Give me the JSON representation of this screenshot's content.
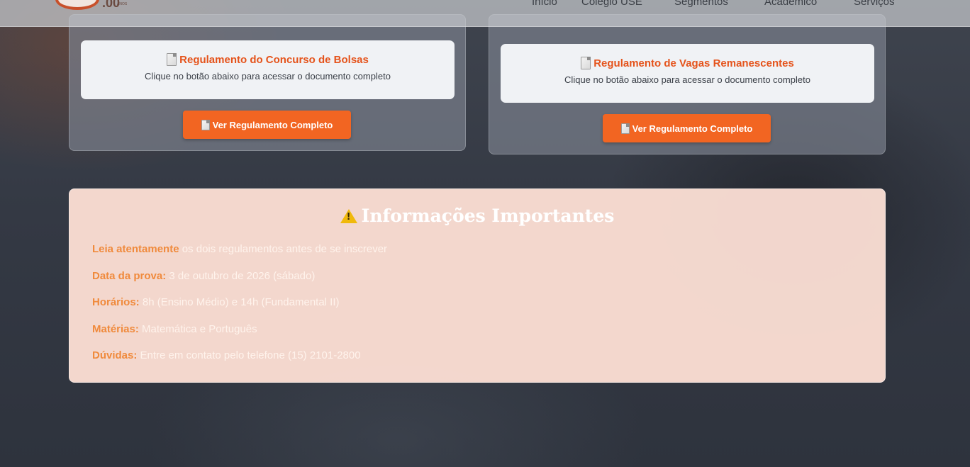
{
  "header": {
    "logo_text": ".00",
    "logo_sub": "ANOS",
    "nav": [
      {
        "label": "Início"
      },
      {
        "label": "Colégio USE"
      },
      {
        "label": "Segmentos"
      },
      {
        "label": "Acadêmico"
      },
      {
        "label": "Serviços"
      }
    ]
  },
  "documents": [
    {
      "icon": "document-icon",
      "title": "Regulamento do Concurso de Bolsas",
      "description": "Clique no botão abaixo para acessar o documento completo",
      "button_label": "Ver Regulamento Completo"
    },
    {
      "icon": "document-icon",
      "title": "Regulamento de Vagas Remanescentes",
      "description": "Clique no botão abaixo para acessar o documento completo",
      "button_label": "Ver Regulamento Completo"
    }
  ],
  "info": {
    "icon": "warning-icon",
    "title": "Informações Importantes",
    "items": [
      {
        "label": "Leia atentamente",
        "value": " os dois regulamentos antes de se inscrever"
      },
      {
        "label": "Data da prova:",
        "value": " 3 de outubro de 2026 (sábado)"
      },
      {
        "label": "Horários:",
        "value": " 8h (Ensino Médio) e 14h (Fundamental II)"
      },
      {
        "label": "Matérias:",
        "value": " Matemática e Português"
      },
      {
        "label": "Dúvidas:",
        "value": " Entre em contato pelo telefone (15) 2101-2800"
      }
    ]
  },
  "colors": {
    "accent": "#f26522",
    "title_orange": "#e5531b",
    "info_bg": "#fbded3"
  }
}
